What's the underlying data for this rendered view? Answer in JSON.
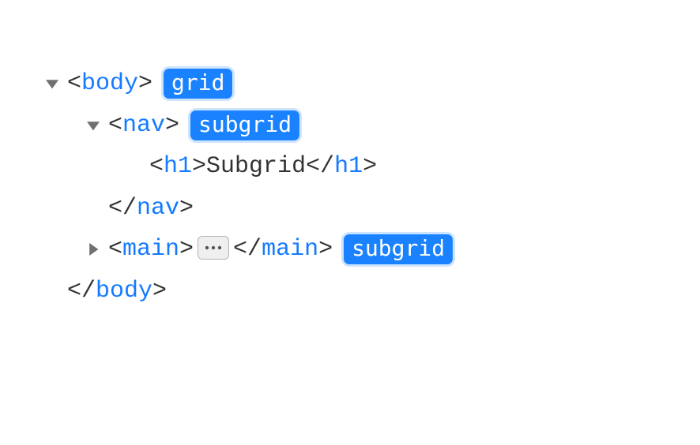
{
  "tree": {
    "row0": {
      "tag": "body",
      "badge": "grid"
    },
    "row1": {
      "tag": "nav",
      "badge": "subgrid"
    },
    "row2": {
      "open_tag": "h1",
      "text": "Subgrid",
      "close_tag": "h1"
    },
    "row3": {
      "close_tag": "nav"
    },
    "row4": {
      "open_tag": "main",
      "close_tag": "main",
      "badge": "subgrid"
    },
    "row5": {
      "close_tag": "body"
    }
  }
}
